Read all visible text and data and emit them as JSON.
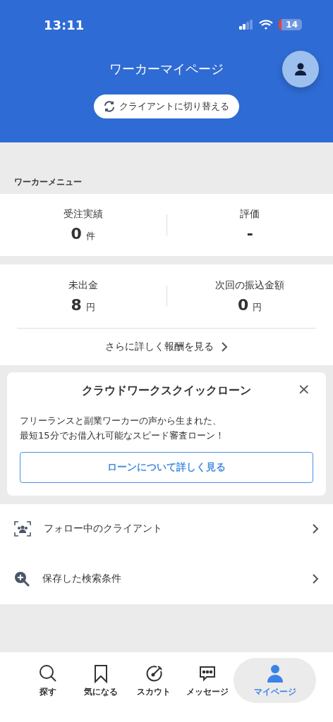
{
  "status_bar": {
    "time": "13:11",
    "battery": "14"
  },
  "header": {
    "title": "ワーカーマイページ",
    "switch_button": "クライアントに切り替える"
  },
  "section_title": "ワーカーメニュー",
  "stats": [
    {
      "label": "受注実績",
      "value": "0",
      "unit": "件"
    },
    {
      "label": "評価",
      "value": "-"
    }
  ],
  "earnings": {
    "stats": [
      {
        "label": "未出金",
        "value": "8",
        "unit": "円"
      },
      {
        "label": "次回の振込金額",
        "value": "0",
        "unit": "円"
      }
    ],
    "link": "さらに詳しく報酬を見る"
  },
  "promo": {
    "title": "クラウドワークスクイックローン",
    "close": "×",
    "text": [
      "フリーランスと副業ワーカーの声から生まれた、",
      "最短15分でお借入れ可能なスピード審査ローン！"
    ],
    "button": "ローンについて詳しく見る"
  },
  "menu": [
    {
      "label": "フォロー中のクライアント",
      "kind": "follow"
    },
    {
      "label": "保存した検索条件",
      "kind": "search"
    }
  ],
  "tabs": [
    {
      "label": "探す",
      "kind": "search",
      "selected": false
    },
    {
      "label": "気になる",
      "kind": "bookmark",
      "selected": false
    },
    {
      "label": "スカウト",
      "kind": "scout",
      "selected": false
    },
    {
      "label": "メッセージ",
      "kind": "message",
      "selected": false
    },
    {
      "label": "マイページ",
      "kind": "person",
      "selected": true
    }
  ]
}
